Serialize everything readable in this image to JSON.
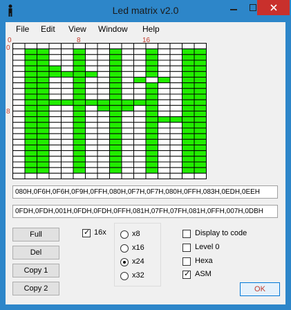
{
  "window": {
    "title": "Led matrix v2.0",
    "accent_color": "#2d86c9",
    "close_color": "#c9302c"
  },
  "menu": [
    "File",
    "Edit",
    "View",
    "Window",
    "Help"
  ],
  "matrix": {
    "column_labels": [
      "0",
      "8",
      "16"
    ],
    "row_labels": [
      "0",
      "8"
    ],
    "on_color": "#22ee00",
    "rows": [
      "................",
      ".XX..X..X..X..XX",
      ".XX..X..X..X..XX",
      ".XX..X..X..X..XX",
      ".XXX.X..X..X..XX",
      ".XXXXXX.X..X..XX",
      ".XX..X..X.X.X.XX",
      ".XX..X..X..X..XX",
      ".XX..X..X..X..XX",
      ".XX..X..X..X..XX",
      ".XXXXXXXXXXX..XX",
      ".XX..X.XXX.X..XX",
      ".XX..X..X..X..XX",
      ".XX..X..X..XXXXX",
      ".XX..X..X..X..XX",
      ".XX..X..X..X..XX",
      ".XX..X..X..X..XX",
      ".XX..X..X..X..XX",
      ".XX..X..X..X..XX",
      ".XX..X..X..X..XX",
      ".XX..X..X..X..XX",
      ".XX..X..X..X..XX",
      ".XX..X..X..X..XX",
      "................"
    ]
  },
  "code_lines": [
    "080H,0F6H,0F6H,0F9H,0FFH,080H,0F7H,0F7H,080H,0FFH,083H,0EDH,0EEH",
    "0FDH,0FDH,001H,0FDH,0FDH,0FFH,081H,07FH,07FH,081H,0FFH,007H,0DBH"
  ],
  "buttons": [
    "Full",
    "Del",
    "Copy 1",
    "Copy 2"
  ],
  "option_16x": {
    "label": "16x",
    "checked": true
  },
  "size_options": [
    {
      "label": "x8",
      "selected": false
    },
    {
      "label": "x16",
      "selected": false
    },
    {
      "label": "x24",
      "selected": true
    },
    {
      "label": "x32",
      "selected": false
    }
  ],
  "checkboxes": [
    {
      "label": "Display to code",
      "checked": false
    },
    {
      "label": "Level 0",
      "checked": false
    },
    {
      "label": "Hexa",
      "checked": false
    },
    {
      "label": "ASM",
      "checked": true
    }
  ],
  "ok_label": "OK"
}
